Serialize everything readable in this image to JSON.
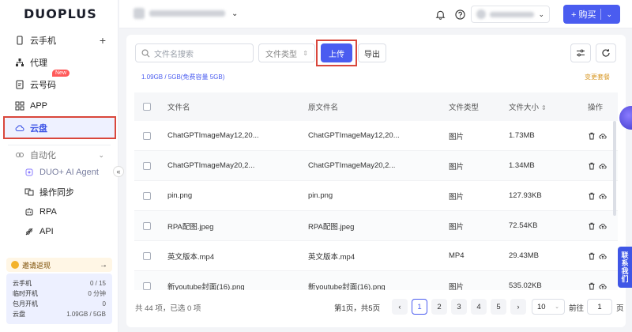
{
  "app": {
    "logo": "DUOPLUS"
  },
  "sidebar": {
    "items": [
      {
        "label": "云手机",
        "icon": "phone-icon",
        "action": "+"
      },
      {
        "label": "代理",
        "icon": "network-icon"
      },
      {
        "label": "云号码",
        "icon": "sim-icon",
        "badge": "New"
      },
      {
        "label": "APP",
        "icon": "apps-grid-icon"
      },
      {
        "label": "云盘",
        "icon": "cloud-icon",
        "active": true
      }
    ],
    "automation": {
      "label": "自动化",
      "children": [
        {
          "label": "DUO+ AI Agent",
          "icon": "agent-icon"
        },
        {
          "label": "操作同步",
          "icon": "sync-icon"
        },
        {
          "label": "RPA",
          "icon": "robot-icon"
        },
        {
          "label": "API",
          "icon": "api-icon"
        }
      ]
    },
    "invite": {
      "label": "邀请返现",
      "arrow": "→"
    },
    "quota": [
      {
        "label": "云手机",
        "value": "0 / 15"
      },
      {
        "label": "临时开机",
        "value": "0 分钟"
      },
      {
        "label": "包月开机",
        "value": "0"
      },
      {
        "label": "云盘",
        "value": "1.09GB / 5GB"
      }
    ]
  },
  "header": {
    "buy_label": "+ 购买",
    "icons": [
      "bell-icon",
      "help-icon"
    ]
  },
  "toolbar": {
    "search_placeholder": "文件名搜索",
    "type_placeholder": "文件类型",
    "upload_label": "上传",
    "export_label": "导出",
    "storage_text": "1.09GB / 5GB(免费容量 5GB)",
    "change_plan": "变更套餐"
  },
  "table": {
    "columns": [
      "文件名",
      "原文件名",
      "文件类型",
      "文件大小",
      "操作"
    ],
    "rows": [
      {
        "name": "ChatGPTImageMay12,20...",
        "original": "ChatGPTImageMay12,20...",
        "type": "图片",
        "size": "1.73MB"
      },
      {
        "name": "ChatGPTImageMay20,2...",
        "original": "ChatGPTImageMay20,2...",
        "type": "图片",
        "size": "1.34MB"
      },
      {
        "name": "pin.png",
        "original": "pin.png",
        "type": "图片",
        "size": "127.93KB"
      },
      {
        "name": "RPA配图.jpeg",
        "original": "RPA配图.jpeg",
        "type": "图片",
        "size": "72.54KB"
      },
      {
        "name": "英文版本.mp4",
        "original": "英文版本.mp4",
        "type": "MP4",
        "size": "29.43MB"
      },
      {
        "name": "新youtube封面(16).png",
        "original": "新youtube封面(16).png",
        "type": "图片",
        "size": "535.02KB"
      }
    ]
  },
  "pagination": {
    "total_text": "共 44 项，已选 0 项",
    "page_text": "第1页，共5页",
    "pages": [
      "1",
      "2",
      "3",
      "4",
      "5"
    ],
    "current": "1",
    "page_size": "10",
    "goto_label": "前往",
    "goto_value": "1",
    "page_suffix": "页"
  },
  "contact": {
    "label": "联系我们"
  }
}
